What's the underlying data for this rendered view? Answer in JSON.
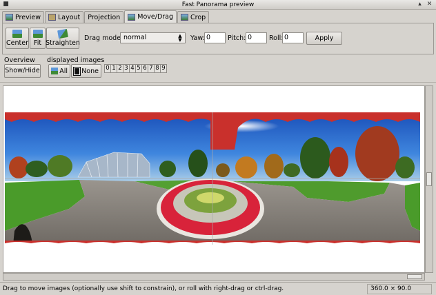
{
  "window": {
    "title": "Fast Panorama preview"
  },
  "tabs": [
    {
      "label": "Preview",
      "icon": "preview-icon"
    },
    {
      "label": "Layout",
      "icon": "layout-icon"
    },
    {
      "label": "Projection",
      "icon": ""
    },
    {
      "label": "Move/Drag",
      "icon": "move-drag-icon",
      "active": true
    },
    {
      "label": "Crop",
      "icon": "crop-icon"
    }
  ],
  "toolbar": {
    "center_label": "Center",
    "fit_label": "Fit",
    "straighten_label": "Straighten",
    "drag_mode_label": "Drag mode:",
    "drag_mode_value": "normal",
    "yaw_label": "Yaw:",
    "yaw_value": "0",
    "pitch_label": "Pitch:",
    "pitch_value": "0",
    "roll_label": "Roll:",
    "roll_value": "0",
    "apply_label": "Apply"
  },
  "overview": {
    "label": "Overview",
    "show_hide_label": "Show/Hide"
  },
  "displayed_images": {
    "label": "displayed images",
    "all_label": "All",
    "none_label": "None",
    "numbers": [
      "0",
      "1",
      "2",
      "3",
      "4",
      "5",
      "6",
      "7",
      "8",
      "9"
    ]
  },
  "status": {
    "message": "Drag to move images (optionally use shift to constrain), or roll with right-drag or ctrl-drag.",
    "fov": "360.0 × 90.0"
  },
  "colors": {
    "window_bg": "#d6d3ce",
    "sky": "#2a64c8",
    "mask_red": "#c9302c",
    "grass": "#4a9b2a",
    "path": "#8d8882",
    "flowers": "#d8233a"
  }
}
